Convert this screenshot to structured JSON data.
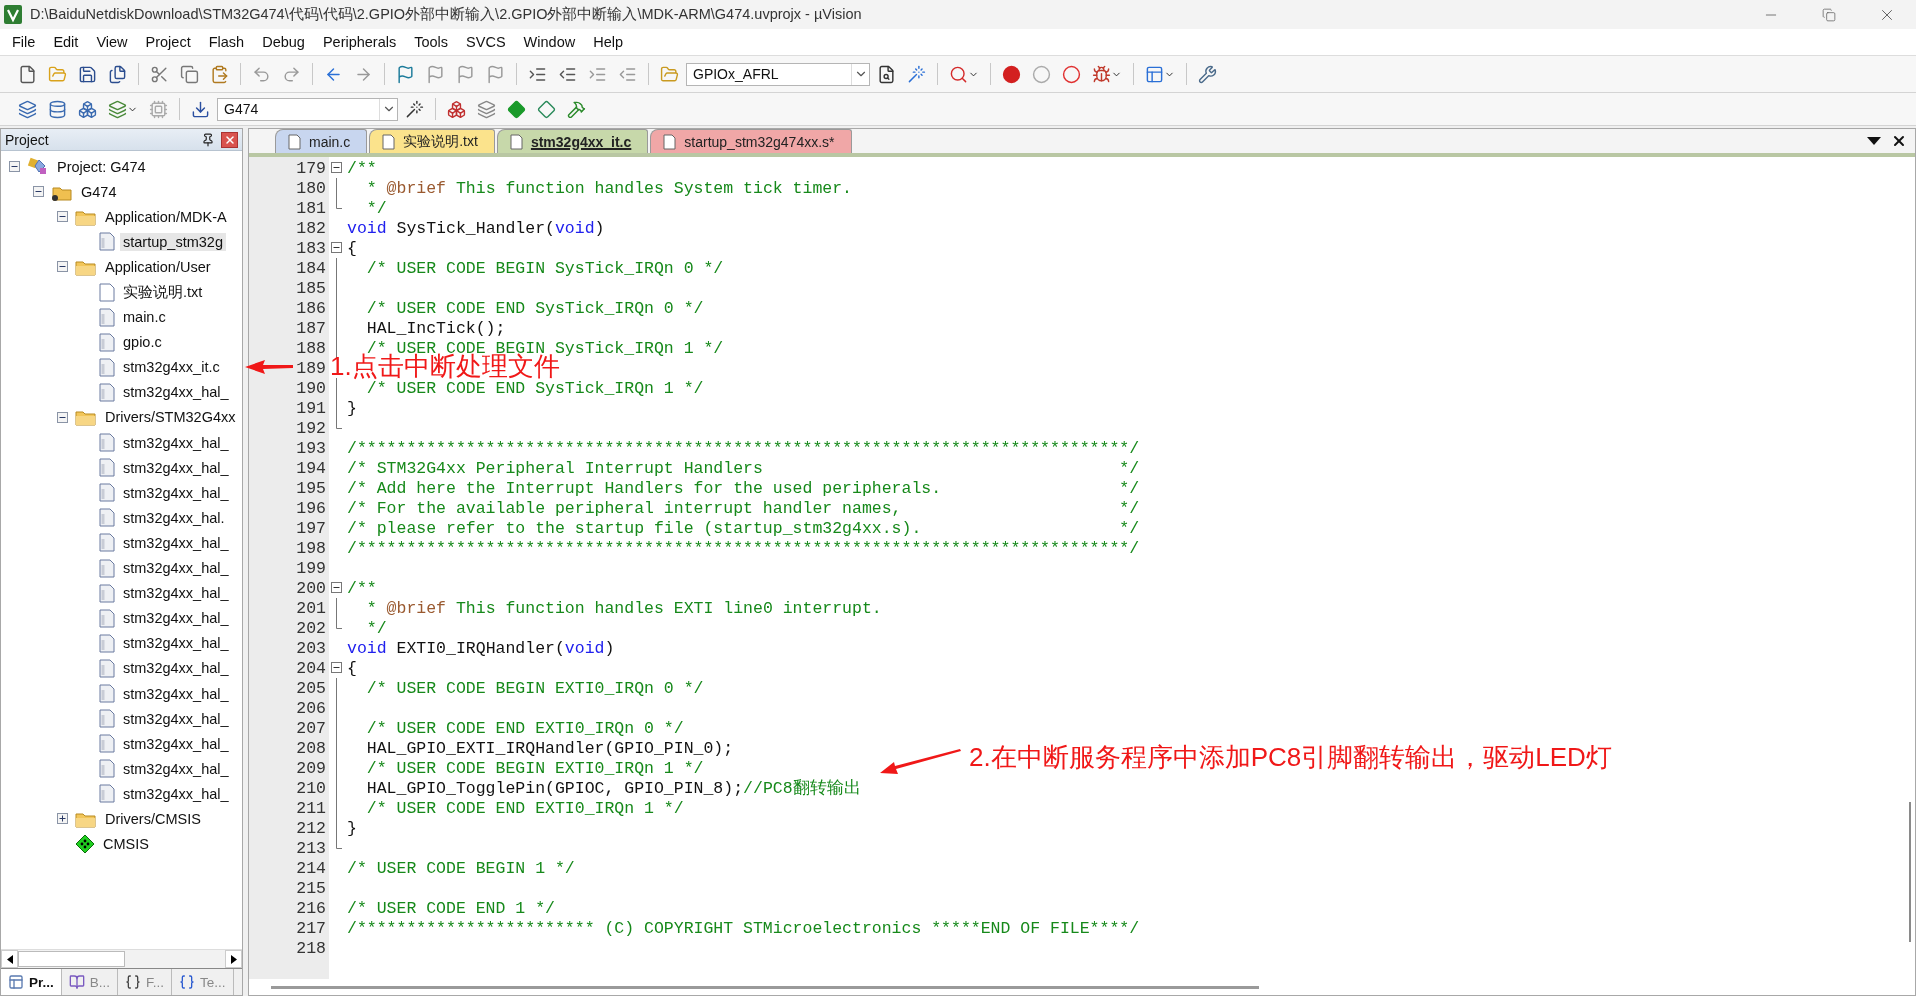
{
  "window": {
    "title": "D:\\BaiduNetdiskDownload\\STM32G474\\代码\\代码\\2.GPIO外部中断输入\\2.GPIO外部中断输入\\MDK-ARM\\G474.uvprojx - µVision"
  },
  "menu": [
    "File",
    "Edit",
    "View",
    "Project",
    "Flash",
    "Debug",
    "Peripherals",
    "Tools",
    "SVCS",
    "Window",
    "Help"
  ],
  "toolbar": {
    "find_combo": "GPIOx_AFRL"
  },
  "build_toolbar": {
    "target_combo": "G474"
  },
  "project_panel": {
    "title": "Project",
    "tree": [
      {
        "label": "Project: G474",
        "kind": "project",
        "expanded": true,
        "selected": false,
        "children": [
          {
            "label": "G474",
            "kind": "target",
            "expanded": true,
            "selected": false,
            "children": [
              {
                "label": "Application/MDK-A",
                "kind": "group",
                "expanded": true,
                "selected": false,
                "children": [
                  {
                    "label": "startup_stm32g",
                    "kind": "file",
                    "selected": true
                  }
                ]
              },
              {
                "label": "Application/User",
                "kind": "group",
                "expanded": true,
                "selected": false,
                "children": [
                  {
                    "label": "实验说明.txt",
                    "kind": "text",
                    "selected": false
                  },
                  {
                    "label": "main.c",
                    "kind": "file",
                    "selected": false
                  },
                  {
                    "label": "gpio.c",
                    "kind": "file",
                    "selected": false
                  },
                  {
                    "label": "stm32g4xx_it.c",
                    "kind": "file",
                    "selected": false
                  },
                  {
                    "label": "stm32g4xx_hal_",
                    "kind": "file",
                    "selected": false
                  }
                ]
              },
              {
                "label": "Drivers/STM32G4xx",
                "kind": "group",
                "expanded": true,
                "selected": false,
                "children": [
                  {
                    "label": "stm32g4xx_hal_",
                    "kind": "file",
                    "selected": false
                  },
                  {
                    "label": "stm32g4xx_hal_",
                    "kind": "file",
                    "selected": false
                  },
                  {
                    "label": "stm32g4xx_hal_",
                    "kind": "file",
                    "selected": false
                  },
                  {
                    "label": "stm32g4xx_hal.",
                    "kind": "file",
                    "selected": false
                  },
                  {
                    "label": "stm32g4xx_hal_",
                    "kind": "file",
                    "selected": false
                  },
                  {
                    "label": "stm32g4xx_hal_",
                    "kind": "file",
                    "selected": false
                  },
                  {
                    "label": "stm32g4xx_hal_",
                    "kind": "file",
                    "selected": false
                  },
                  {
                    "label": "stm32g4xx_hal_",
                    "kind": "file",
                    "selected": false
                  },
                  {
                    "label": "stm32g4xx_hal_",
                    "kind": "file",
                    "selected": false
                  },
                  {
                    "label": "stm32g4xx_hal_",
                    "kind": "file",
                    "selected": false
                  },
                  {
                    "label": "stm32g4xx_hal_",
                    "kind": "file",
                    "selected": false
                  },
                  {
                    "label": "stm32g4xx_hal_",
                    "kind": "file",
                    "selected": false
                  },
                  {
                    "label": "stm32g4xx_hal_",
                    "kind": "file",
                    "selected": false
                  },
                  {
                    "label": "stm32g4xx_hal_",
                    "kind": "file",
                    "selected": false
                  },
                  {
                    "label": "stm32g4xx_hal_",
                    "kind": "file",
                    "selected": false
                  }
                ]
              },
              {
                "label": "Drivers/CMSIS",
                "kind": "group",
                "expanded": false,
                "selected": false
              },
              {
                "label": "CMSIS",
                "kind": "component",
                "selected": false
              }
            ]
          }
        ]
      }
    ],
    "bottom_tabs": [
      {
        "label": "Pr...",
        "kind": "project",
        "selected": true
      },
      {
        "label": "B...",
        "kind": "books",
        "selected": false
      },
      {
        "label": "F...",
        "kind": "functions",
        "selected": false
      },
      {
        "label": "Te...",
        "kind": "templates",
        "selected": false
      }
    ]
  },
  "editor": {
    "tabs": [
      {
        "label": "main.c",
        "selected": false,
        "color": "#c8d6ef"
      },
      {
        "label": "实验说明.txt",
        "selected": false,
        "color": "#fbe38c"
      },
      {
        "label": "stm32g4xx_it.c",
        "selected": true,
        "color": "#c7d8aa"
      },
      {
        "label": "startup_stm32g474xx.s*",
        "selected": false,
        "color": "#f0a7a7"
      }
    ],
    "lines": [
      {
        "number": "179",
        "kind": "fold-start",
        "segments": [
          {
            "kind": "comment",
            "text": "/**"
          }
        ]
      },
      {
        "number": "180",
        "kind": "fold-body",
        "segments": [
          {
            "kind": "comment",
            "text": "  * "
          },
          {
            "kind": "tag",
            "text": "@brief"
          },
          {
            "kind": "comment",
            "text": " This function handles System tick timer."
          }
        ]
      },
      {
        "number": "181",
        "kind": "fold-end",
        "segments": [
          {
            "kind": "comment",
            "text": "  */"
          }
        ]
      },
      {
        "number": "182",
        "kind": "plain",
        "segments": [
          {
            "kind": "keyword",
            "text": "void"
          },
          {
            "kind": "code",
            "text": " SysTick_Handler("
          },
          {
            "kind": "keyword",
            "text": "void"
          },
          {
            "kind": "code",
            "text": ")"
          }
        ]
      },
      {
        "number": "183",
        "kind": "fold-start",
        "segments": [
          {
            "kind": "code",
            "text": "{"
          }
        ]
      },
      {
        "number": "184",
        "kind": "fold-body",
        "segments": [
          {
            "kind": "comment",
            "text": "  /* USER CODE BEGIN SysTick_IRQn 0 */"
          }
        ]
      },
      {
        "number": "185",
        "kind": "fold-body"
      },
      {
        "number": "186",
        "kind": "fold-body",
        "segments": [
          {
            "kind": "comment",
            "text": "  /* USER CODE END SysTick_IRQn 0 */"
          }
        ]
      },
      {
        "number": "187",
        "kind": "fold-body",
        "segments": [
          {
            "kind": "code",
            "text": "  HAL_IncTick();"
          }
        ]
      },
      {
        "number": "188",
        "kind": "fold-body",
        "segments": [
          {
            "kind": "comment",
            "text": "  /* USER CODE BEGIN SysTick_IRQn 1 */"
          }
        ]
      },
      {
        "number": "189",
        "kind": "plain"
      },
      {
        "number": "190",
        "kind": "fold-body",
        "segments": [
          {
            "kind": "comment",
            "text": "  /* USER CODE END SysTick_IRQn 1 */"
          }
        ]
      },
      {
        "number": "191",
        "kind": "fold-body",
        "segments": [
          {
            "kind": "code",
            "text": "}"
          }
        ]
      },
      {
        "number": "192",
        "kind": "fold-end"
      },
      {
        "number": "193",
        "kind": "plain",
        "segments": [
          {
            "kind": "comment",
            "text": "/******************************************************************************/"
          }
        ]
      },
      {
        "number": "194",
        "kind": "plain",
        "segments": [
          {
            "kind": "comment",
            "text": "/* STM32G4xx Peripheral Interrupt Handlers                                    */"
          }
        ]
      },
      {
        "number": "195",
        "kind": "plain",
        "segments": [
          {
            "kind": "comment",
            "text": "/* Add here the Interrupt Handlers for the used peripherals.                  */"
          }
        ]
      },
      {
        "number": "196",
        "kind": "plain",
        "segments": [
          {
            "kind": "comment",
            "text": "/* For the available peripheral interrupt handler names,                      */"
          }
        ]
      },
      {
        "number": "197",
        "kind": "plain",
        "segments": [
          {
            "kind": "comment",
            "text": "/* please refer to the startup file (startup_stm32g4xx.s).                    */"
          }
        ]
      },
      {
        "number": "198",
        "kind": "plain",
        "segments": [
          {
            "kind": "comment",
            "text": "/******************************************************************************/"
          }
        ]
      },
      {
        "number": "199",
        "kind": "plain"
      },
      {
        "number": "200",
        "kind": "fold-start",
        "segments": [
          {
            "kind": "comment",
            "text": "/**"
          }
        ]
      },
      {
        "number": "201",
        "kind": "fold-body",
        "segments": [
          {
            "kind": "comment",
            "text": "  * "
          },
          {
            "kind": "tag",
            "text": "@brief"
          },
          {
            "kind": "comment",
            "text": " This function handles EXTI line0 interrupt."
          }
        ]
      },
      {
        "number": "202",
        "kind": "fold-end",
        "segments": [
          {
            "kind": "comment",
            "text": "  */"
          }
        ]
      },
      {
        "number": "203",
        "kind": "plain",
        "segments": [
          {
            "kind": "keyword",
            "text": "void"
          },
          {
            "kind": "code",
            "text": " EXTI0_IRQHandler("
          },
          {
            "kind": "keyword",
            "text": "void"
          },
          {
            "kind": "code",
            "text": ")"
          }
        ]
      },
      {
        "number": "204",
        "kind": "fold-start",
        "segments": [
          {
            "kind": "code",
            "text": "{"
          }
        ]
      },
      {
        "number": "205",
        "kind": "fold-body",
        "segments": [
          {
            "kind": "comment",
            "text": "  /* USER CODE BEGIN EXTI0_IRQn 0 */"
          }
        ]
      },
      {
        "number": "206",
        "kind": "fold-body"
      },
      {
        "number": "207",
        "kind": "fold-body",
        "segments": [
          {
            "kind": "comment",
            "text": "  /* USER CODE END EXTI0_IRQn 0 */"
          }
        ]
      },
      {
        "number": "208",
        "kind": "fold-body",
        "segments": [
          {
            "kind": "code",
            "text": "  HAL_GPIO_EXTI_IRQHandler(GPIO_PIN_0);"
          }
        ]
      },
      {
        "number": "209",
        "kind": "fold-body",
        "segments": [
          {
            "kind": "comment",
            "text": "  /* USER CODE BEGIN EXTI0_IRQn 1 */"
          }
        ]
      },
      {
        "number": "210",
        "kind": "fold-body",
        "segments": [
          {
            "kind": "code",
            "text": "  HAL_GPIO_TogglePin(GPIOC, GPIO_PIN_8);"
          },
          {
            "kind": "comment",
            "text": "//PC8翻转输出"
          }
        ]
      },
      {
        "number": "211",
        "kind": "fold-body",
        "segments": [
          {
            "kind": "comment",
            "text": "  /* USER CODE END EXTI0_IRQn 1 */"
          }
        ]
      },
      {
        "number": "212",
        "kind": "fold-body",
        "segments": [
          {
            "kind": "code",
            "text": "}"
          }
        ]
      },
      {
        "number": "213",
        "kind": "fold-end"
      },
      {
        "number": "214",
        "kind": "plain",
        "segments": [
          {
            "kind": "comment",
            "text": "/* USER CODE BEGIN 1 */"
          }
        ]
      },
      {
        "number": "215",
        "kind": "plain"
      },
      {
        "number": "216",
        "kind": "plain",
        "segments": [
          {
            "kind": "comment",
            "text": "/* USER CODE END 1 */"
          }
        ]
      },
      {
        "number": "217",
        "kind": "plain",
        "segments": [
          {
            "kind": "comment",
            "text": "/************************ (C) COPYRIGHT STMicroelectronics *****END OF FILE****/"
          }
        ]
      },
      {
        "number": "218",
        "kind": "plain"
      }
    ]
  },
  "annotations": [
    {
      "text": "1.点击中断处理文件"
    },
    {
      "text": "2.在中断服务程序中添加PC8引脚翻转输出，驱动LED灯"
    }
  ]
}
